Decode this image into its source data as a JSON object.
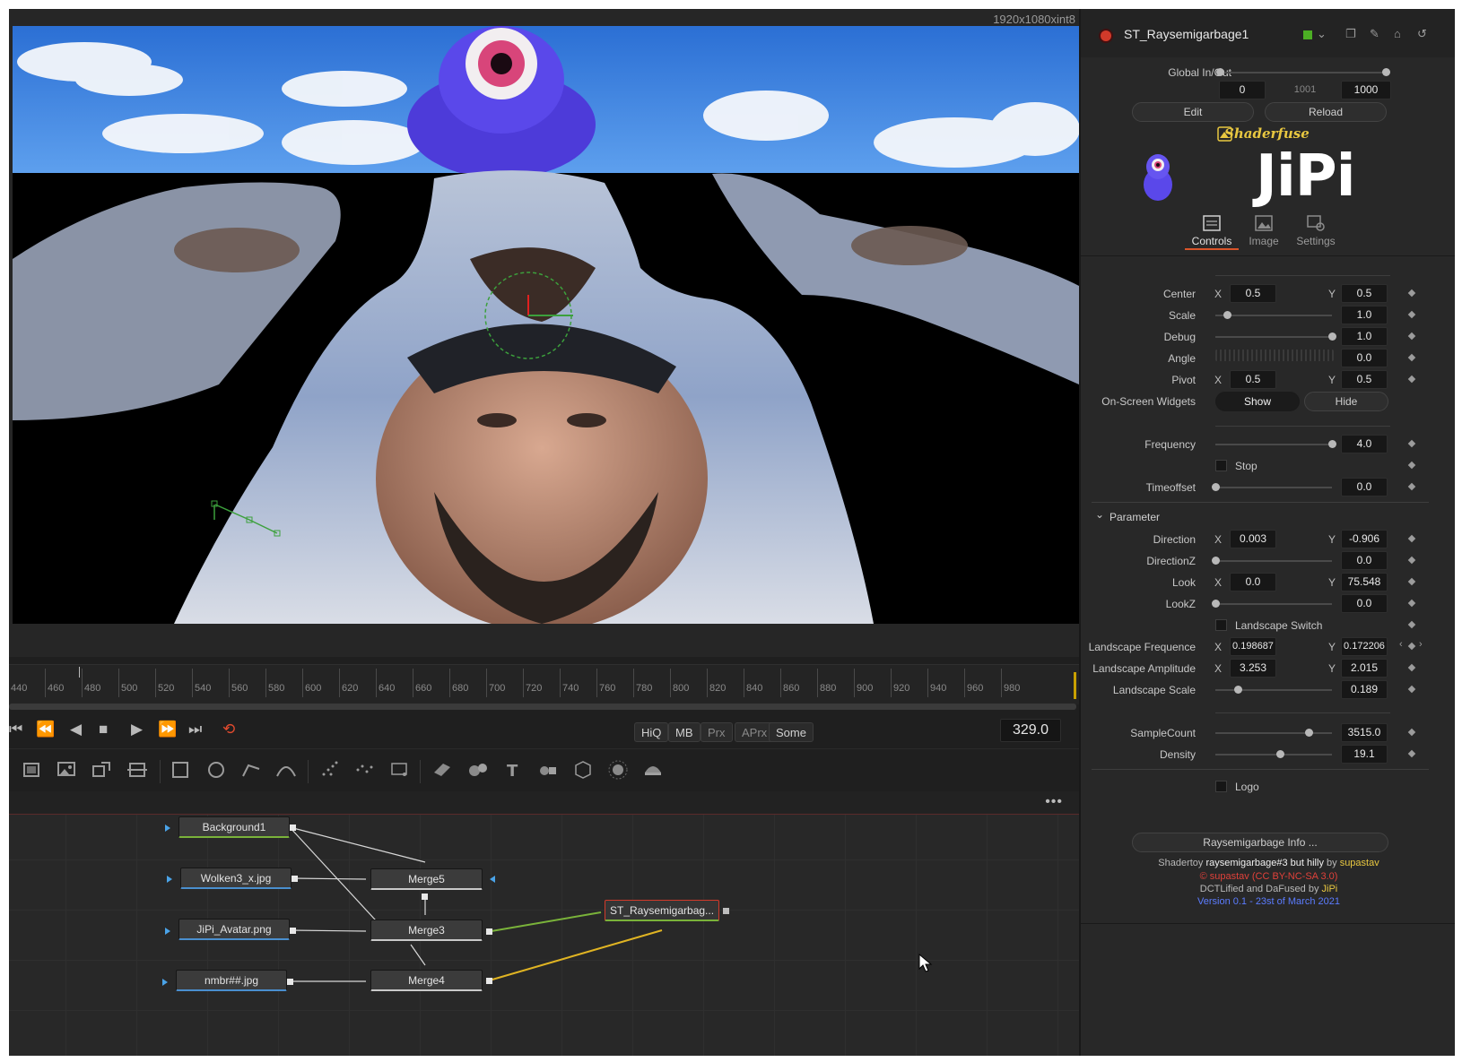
{
  "viewer": {
    "resolution": "1920x1080xint8"
  },
  "timeline": {
    "ticks": [
      "440",
      "460",
      "480",
      "500",
      "520",
      "540",
      "560",
      "580",
      "600",
      "620",
      "640",
      "660",
      "680",
      "700",
      "720",
      "740",
      "760",
      "780",
      "800",
      "820",
      "840",
      "860",
      "880",
      "900",
      "920",
      "940",
      "960",
      "980"
    ],
    "quality_buttons": [
      "HiQ",
      "MB",
      "Prx",
      "APrx",
      "Some"
    ],
    "current_frame": "329.0"
  },
  "nodes": {
    "background": "Background1",
    "wolken": "Wolken3_x.jpg",
    "avatar": "JiPi_Avatar.png",
    "nmbr": "nmbr##.jpg",
    "merge5": "Merge5",
    "merge3": "Merge3",
    "merge4": "Merge4",
    "fuse": "ST_Raysemigarbag..."
  },
  "inspector": {
    "tool_name": "ST_Raysemigarbage1",
    "global_inout_label": "Global In/Out",
    "global_in": "0",
    "global_mid": "1001",
    "global_out": "1000",
    "edit_label": "Edit",
    "reload_label": "Reload",
    "shaderfuse_label": "Shaderfuse",
    "logo_text": "JiPi",
    "tabs": {
      "controls": "Controls",
      "image": "Image",
      "settings": "Settings"
    },
    "center": {
      "label": "Center",
      "x": "0.5",
      "y": "0.5"
    },
    "scale": {
      "label": "Scale",
      "value": "1.0",
      "level": 0.1
    },
    "debug": {
      "label": "Debug",
      "value": "1.0",
      "level": 1.0
    },
    "angle": {
      "label": "Angle",
      "value": "0.0"
    },
    "pivot": {
      "label": "Pivot",
      "x": "0.5",
      "y": "0.5"
    },
    "onscreen": {
      "label": "On-Screen Widgets",
      "show": "Show",
      "hide": "Hide"
    },
    "frequency": {
      "label": "Frequency",
      "value": "4.0",
      "level": 1.0
    },
    "stop_label": "Stop",
    "timeoffset": {
      "label": "Timeoffset",
      "value": "0.0",
      "level": 0.0
    },
    "parameter_label": "Parameter",
    "direction": {
      "label": "Direction",
      "x": "0.003",
      "y": "-0.906"
    },
    "directionz": {
      "label": "DirectionZ",
      "value": "0.0",
      "level": 0.0
    },
    "look": {
      "label": "Look",
      "x": "0.0",
      "y": "75.548"
    },
    "lookz": {
      "label": "LookZ",
      "value": "0.0",
      "level": 0.0
    },
    "landscape_switch": "Landscape Switch",
    "landscape_frequence": {
      "label": "Landscape Frequence",
      "x": "0.198687",
      "y": "0.172206"
    },
    "landscape_amplitude": {
      "label": "Landscape Amplitude",
      "x": "3.253",
      "y": "2.015"
    },
    "landscape_scale": {
      "label": "Landscape Scale",
      "value": "0.189",
      "level": 0.19
    },
    "samplecount": {
      "label": "SampleCount",
      "value": "3515.0",
      "level": 0.8
    },
    "density": {
      "label": "Density",
      "value": "19.1",
      "level": 0.55
    },
    "logo_label": "Logo",
    "x_label": "X",
    "y_label": "Y",
    "info_button": "Raysemigarbage Info ...",
    "info": {
      "line1_a": "Shadertoy ",
      "line1_b": "raysemigarbage#3 but hilly",
      "line1_c": " by ",
      "line1_d": "supastav",
      "line2": "© supastav (CC BY-NC-SA 3.0)",
      "line3_a": "DCTLified and DaFused by ",
      "line3_b": "JiPi",
      "line4": "Version 0.1 - 23st of March 2021"
    }
  },
  "colors": {
    "accent_orange": "#d9552a",
    "selection_red": "#d23a2a",
    "link_yellow": "#e8c740",
    "link_blue": "#5b7cff",
    "license_red": "#e0413a",
    "wire_green": "#7ab33a",
    "wire_yellow": "#e0b423"
  }
}
